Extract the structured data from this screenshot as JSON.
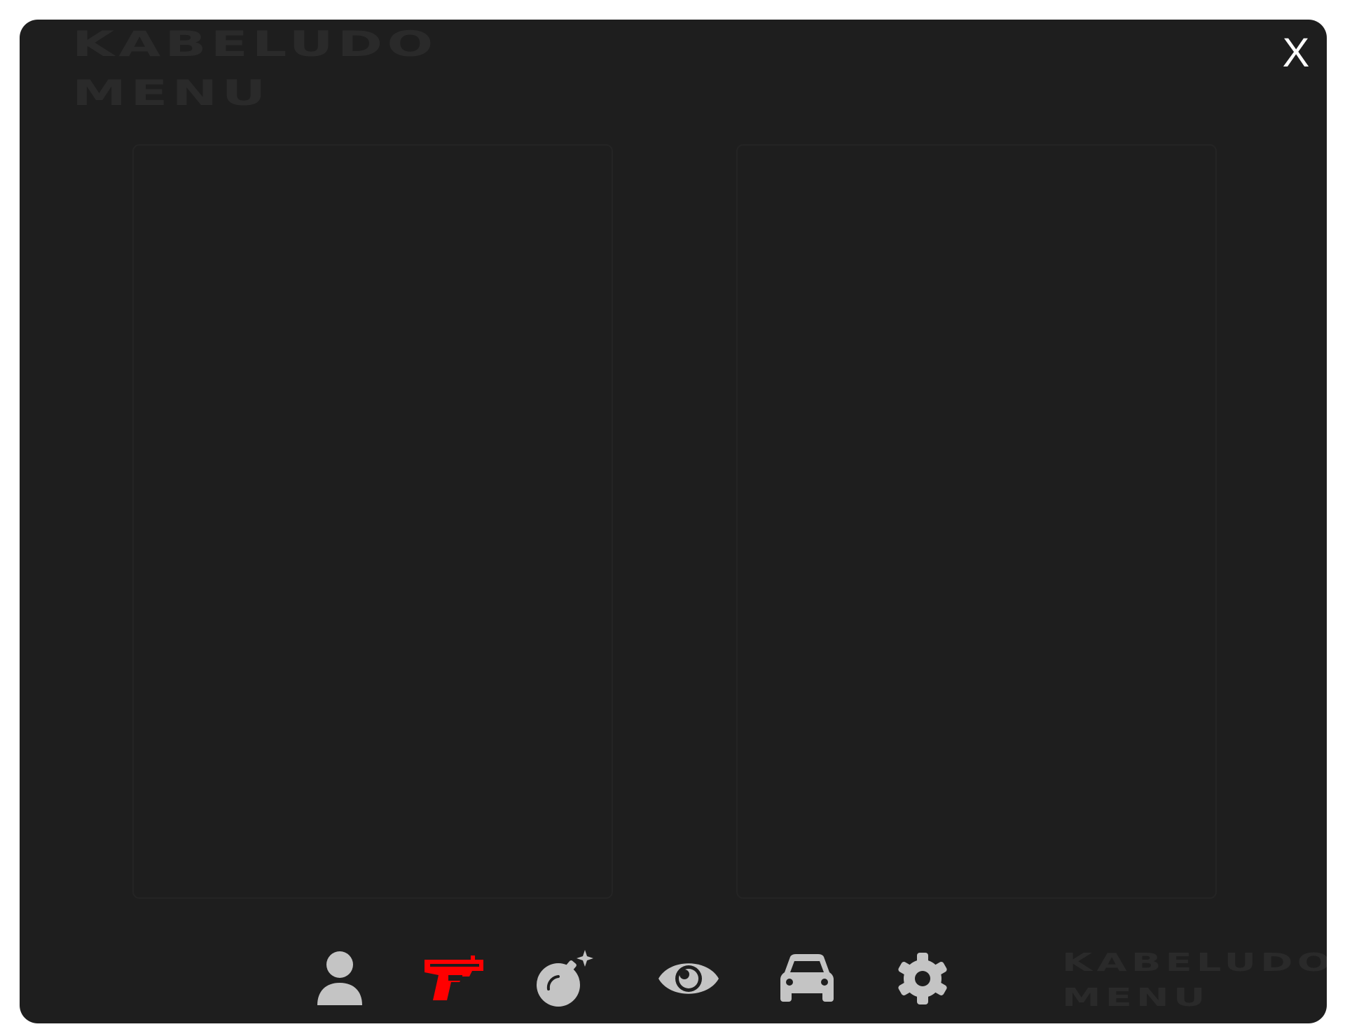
{
  "logo": {
    "line1": "KABELUDO",
    "line2": "MENU"
  },
  "window": {
    "close_label": "X"
  },
  "nav": {
    "items": [
      {
        "icon": "user-icon",
        "active": false
      },
      {
        "icon": "gun-icon",
        "active": true
      },
      {
        "icon": "bomb-icon",
        "active": false
      },
      {
        "icon": "eye-icon",
        "active": false
      },
      {
        "icon": "car-icon",
        "active": false
      },
      {
        "icon": "gear-icon",
        "active": false
      }
    ]
  },
  "colors": {
    "background": "#1e1e1e",
    "icon_default": "#c4c4c4",
    "icon_active": "#ff0000",
    "close": "#ffffff"
  }
}
